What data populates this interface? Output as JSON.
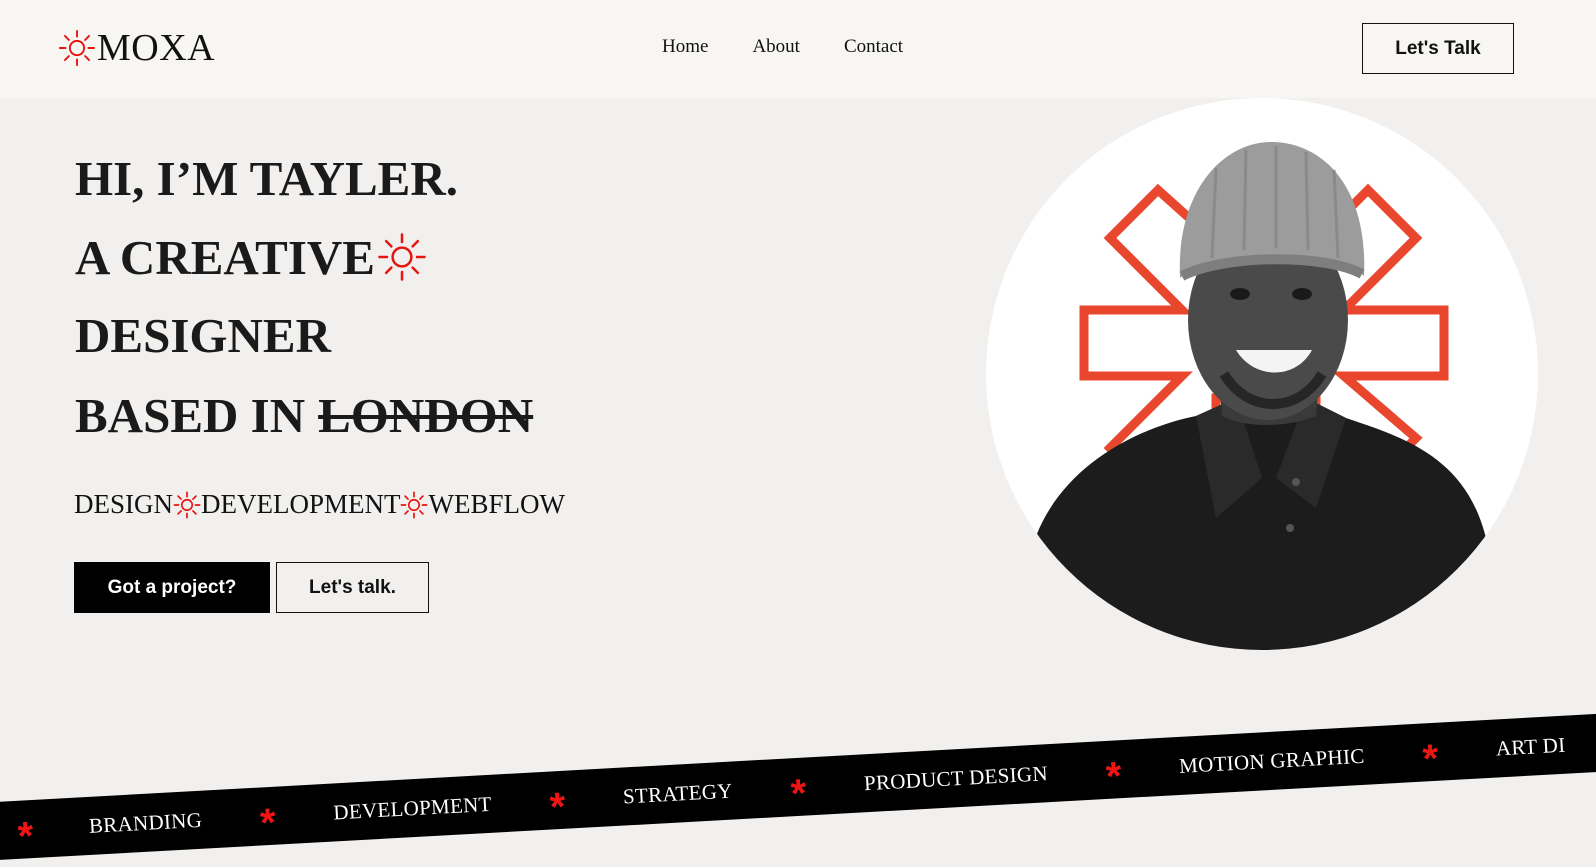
{
  "brand": {
    "name": "MOXA",
    "accent_color": "#e8150f",
    "icon": "sun-icon"
  },
  "nav": {
    "items": [
      {
        "label": "Home"
      },
      {
        "label": "About"
      },
      {
        "label": "Contact"
      }
    ],
    "cta_label": "Let's Talk"
  },
  "hero": {
    "line1": "HI, I’M TAYLER.",
    "line2": "A CREATIVE",
    "line3": "DESIGNER",
    "line4_prefix": "BASED IN",
    "line4_struck": "LONDON",
    "services": [
      "DESIGN",
      "DEVELOPMENT",
      "WEBFLOW"
    ],
    "primary_button": "Got a project?",
    "secondary_button": "Let's talk."
  },
  "portrait": {
    "description_icon": "portrait-photo",
    "shape_color": "#e8472e"
  },
  "ticker": {
    "items": [
      "BRANDING",
      "DEVELOPMENT",
      "STRATEGY",
      "PRODUCT DESIGN",
      "MOTION GRAPHIC",
      "ART DI"
    ],
    "separator": "*"
  }
}
